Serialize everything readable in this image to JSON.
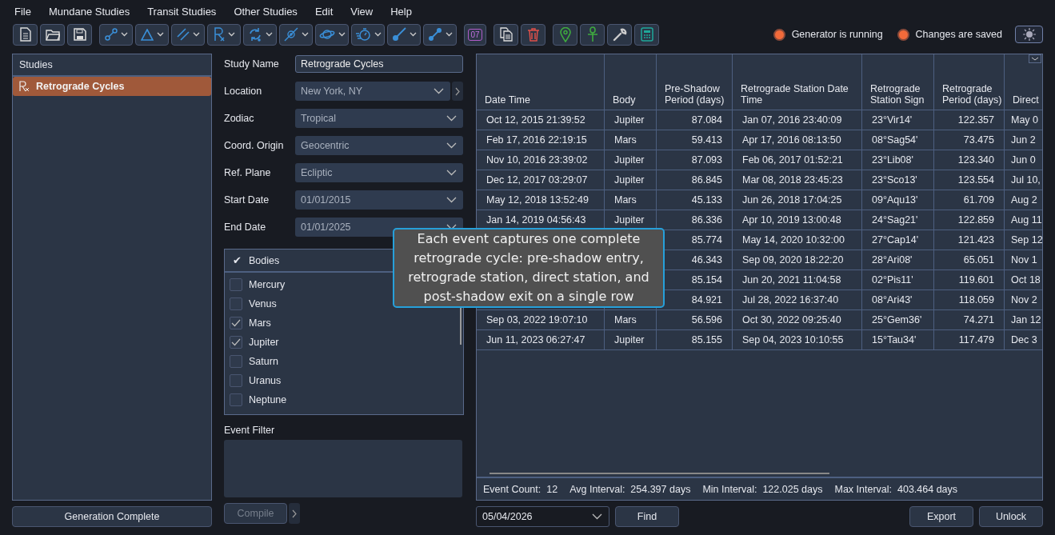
{
  "menu": [
    "File",
    "Mundane Studies",
    "Transit Studies",
    "Other Studies",
    "Edit",
    "View",
    "Help"
  ],
  "toolbar": [
    [
      {
        "kind": "plain"
      },
      {
        "kind": "plain"
      },
      {
        "kind": "plain"
      }
    ],
    [
      {
        "kind": "dropdown"
      },
      {
        "kind": "dropdown"
      },
      {
        "kind": "dropdown"
      },
      {
        "kind": "dropdown"
      },
      {
        "kind": "dropdown"
      },
      {
        "kind": "dropdown"
      },
      {
        "kind": "dropdown"
      },
      {
        "kind": "dropdown"
      },
      {
        "kind": "dropdown"
      },
      {
        "kind": "dropdown"
      }
    ],
    [
      {
        "kind": "calendar",
        "label": "07"
      }
    ],
    [
      {
        "kind": "plain"
      },
      {
        "kind": "plain"
      }
    ],
    [
      {
        "kind": "plain"
      },
      {
        "kind": "plain"
      },
      {
        "kind": "plain"
      },
      {
        "kind": "plain"
      }
    ]
  ],
  "status": [
    {
      "label": "Generator is running",
      "on": true
    },
    {
      "label": "Changes are saved",
      "on": true
    }
  ],
  "theme": {
    "light": false
  },
  "studies": {
    "title": "Studies",
    "items": [
      {
        "label": "Retrograde Cycles",
        "selected": true
      }
    ]
  },
  "form": [
    {
      "label": "Study Name",
      "value": "Retrograde Cycles",
      "kind": "text"
    },
    {
      "label": "Location",
      "value": "New York, NY",
      "kind": "select-more"
    },
    {
      "label": "Zodiac",
      "value": "Tropical",
      "kind": "select"
    },
    {
      "label": "Coord. Origin",
      "value": "Geocentric",
      "kind": "select"
    },
    {
      "label": "Ref. Plane",
      "value": "Ecliptic",
      "kind": "select"
    },
    {
      "label": "Start Date",
      "value": "01/01/2015",
      "kind": "select"
    },
    {
      "label": "End Date",
      "value": "01/01/2025",
      "kind": "select"
    }
  ],
  "bodies": {
    "mark": "✔",
    "title": "Bodies",
    "items": [
      {
        "label": "Mercury",
        "checked": false
      },
      {
        "label": "Venus",
        "checked": false
      },
      {
        "label": "Mars",
        "checked": true
      },
      {
        "label": "Jupiter",
        "checked": true
      },
      {
        "label": "Saturn",
        "checked": false
      },
      {
        "label": "Uranus",
        "checked": false
      },
      {
        "label": "Neptune",
        "checked": false
      }
    ]
  },
  "event_filter": {
    "label": "Event Filter"
  },
  "table": {
    "columns": [
      "Date Time",
      "Body",
      "Pre-Shadow Period (days)",
      "Retrograde Station Date Time",
      "Retrograde Station Sign",
      "Retrograde Period (days)",
      "Direct"
    ],
    "rows": [
      [
        "Oct 12, 2015 21:39:52",
        "Jupiter",
        "87.084",
        "Jan 07, 2016 23:40:09",
        "23°Vir14'",
        "122.357",
        "May 0"
      ],
      [
        "Feb 17, 2016 22:19:15",
        "Mars",
        "59.413",
        "Apr 17, 2016 08:13:50",
        "08°Sag54'",
        "73.475",
        "Jun 2"
      ],
      [
        "Nov 10, 2016 23:39:02",
        "Jupiter",
        "87.093",
        "Feb 06, 2017 01:52:21",
        "23°Lib08'",
        "123.340",
        "Jun 0"
      ],
      [
        "Dec 12, 2017 03:29:07",
        "Jupiter",
        "86.845",
        "Mar 08, 2018 23:45:23",
        "23°Sco13'",
        "123.554",
        "Jul 10,"
      ],
      [
        "May 12, 2018 13:52:49",
        "Mars",
        "45.133",
        "Jun 26, 2018 17:04:25",
        "09°Aqu13'",
        "61.709",
        "Aug 2"
      ],
      [
        "Jan 14, 2019 04:56:43",
        "Jupiter",
        "86.336",
        "Apr 10, 2019 13:00:48",
        "24°Sag21'",
        "122.859",
        "Aug 11"
      ],
      [
        null,
        null,
        "85.774",
        "May 14, 2020 10:32:00",
        "27°Cap14'",
        "121.423",
        "Sep 12"
      ],
      [
        null,
        null,
        "46.343",
        "Sep 09, 2020 18:22:20",
        "28°Ari08'",
        "65.051",
        "Nov 1"
      ],
      [
        null,
        null,
        "85.154",
        "Jun 20, 2021 11:04:58",
        "02°Pis11'",
        "119.601",
        "Oct 18"
      ],
      [
        null,
        null,
        "84.921",
        "Jul 28, 2022 16:37:40",
        "08°Ari43'",
        "118.059",
        "Nov 2"
      ],
      [
        "Sep 03, 2022 19:07:10",
        "Mars",
        "56.596",
        "Oct 30, 2022 09:25:40",
        "25°Gem36'",
        "74.271",
        "Jan 12"
      ],
      [
        "Jun 11, 2023 06:27:47",
        "Jupiter",
        "85.155",
        "Sep 04, 2023 10:10:55",
        "15°Tau34'",
        "117.479",
        "Dec 3"
      ]
    ]
  },
  "summary": [
    {
      "label": "Event Count:",
      "value": "12"
    },
    {
      "label": "Avg Interval:",
      "value": "254.397 days"
    },
    {
      "label": "Min Interval:",
      "value": "122.025 days"
    },
    {
      "label": "Max Interval:",
      "value": "403.464 days"
    }
  ],
  "tooltip": "Each event captures one complete retrograde cycle: pre-shadow entry, retrograde station, direct station, and post-shadow exit on a single row",
  "bottom": {
    "status_button": "Generation Complete",
    "compile": {
      "label": "Compile",
      "disabled": true
    },
    "date": "05/04/2026",
    "find": "Find",
    "export": "Export",
    "unlock": "Unlock"
  }
}
